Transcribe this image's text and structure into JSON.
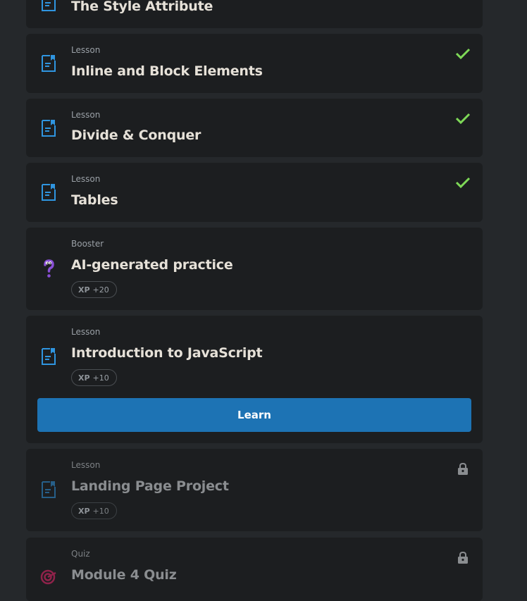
{
  "items": [
    {
      "type": "",
      "title": "The Style Attribute",
      "status": "completed"
    },
    {
      "type": "Lesson",
      "title": "Inline and Block Elements",
      "status": "completed"
    },
    {
      "type": "Lesson",
      "title": "Divide & Conquer",
      "status": "completed"
    },
    {
      "type": "Lesson",
      "title": "Tables",
      "status": "completed"
    },
    {
      "type": "Booster",
      "title": "AI-generated practice",
      "xp_label": "XP",
      "xp_value": "+20"
    },
    {
      "type": "Lesson",
      "title": "Introduction to JavaScript",
      "xp_label": "XP",
      "xp_value": "+10",
      "action_label": "Learn"
    },
    {
      "type": "Lesson",
      "title": "Landing Page Project",
      "xp_label": "XP",
      "xp_value": "+10",
      "status": "locked"
    },
    {
      "type": "Quiz",
      "title": "Module 4 Quiz",
      "status": "locked"
    }
  ],
  "colors": {
    "lesson_icon": "#2f95e0",
    "check": "#7ed957",
    "booster_icon": "#8a4fd6",
    "quiz_icon": "#c0245c",
    "learn_button": "#1d73b4"
  }
}
